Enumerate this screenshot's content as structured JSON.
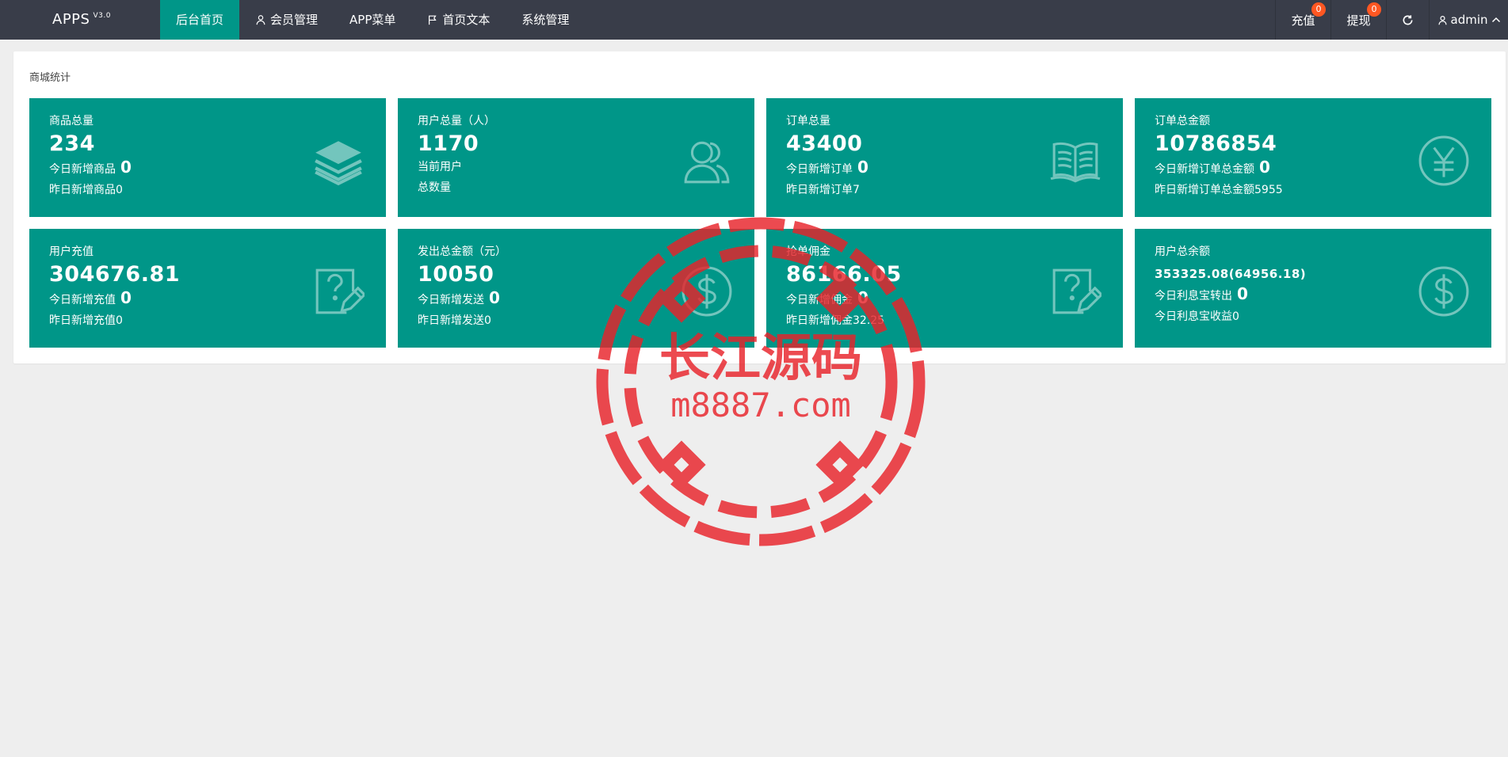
{
  "app": {
    "title": "APPS",
    "version": "V3.0"
  },
  "nav": {
    "items": [
      {
        "label": "后台首页",
        "icon": ""
      },
      {
        "label": "会员管理",
        "icon": "user-icon"
      },
      {
        "label": "APP菜单",
        "icon": ""
      },
      {
        "label": "首页文本",
        "icon": "flag-icon"
      },
      {
        "label": "系统管理",
        "icon": ""
      }
    ]
  },
  "right_nav": {
    "charge_label": "充值",
    "charge_badge": "0",
    "withdraw_label": "提现",
    "withdraw_badge": "0",
    "refresh_icon": "refresh-icon",
    "user_label": "admin"
  },
  "panel": {
    "title": "商城统计"
  },
  "cards": [
    {
      "title": "商品总量",
      "value": "234",
      "line1_label": "今日新增商品",
      "line1_value": "0",
      "line2_label": "昨日新增商品",
      "line2_value": "0",
      "icon": "layers-icon"
    },
    {
      "title": "用户总量（人）",
      "value": "1170",
      "line1_label": "当前用户",
      "line1_value": "",
      "line2_label": "总数量",
      "line2_value": "",
      "icon": "users-icon"
    },
    {
      "title": "订单总量",
      "value": "43400",
      "line1_label": "今日新增订单",
      "line1_value": "0",
      "line2_label": "昨日新增订单",
      "line2_value": "7",
      "icon": "book-icon"
    },
    {
      "title": "订单总金额",
      "value": "10786854",
      "line1_label": "今日新增订单总金额",
      "line1_value": "0",
      "line2_label": "昨日新增订单总金额",
      "line2_value": "5955",
      "icon": "yen-icon"
    },
    {
      "title": "用户充值",
      "value": "304676.81",
      "line1_label": "今日新增充值",
      "line1_value": "0",
      "line2_label": "昨日新增充值",
      "line2_value": "0",
      "icon": "question-doc-icon"
    },
    {
      "title": "发出总金额（元）",
      "value": "10050",
      "line1_label": "今日新增发送",
      "line1_value": "0",
      "line2_label": "昨日新增发送",
      "line2_value": "0",
      "icon": "dollar-icon"
    },
    {
      "title": "抢单佣金",
      "value": "86166.05",
      "line1_label": "今日新增佣金",
      "line1_value": "0",
      "line2_label": "昨日新增佣金",
      "line2_value": "32.25",
      "icon": "question-doc-icon"
    },
    {
      "title": "用户总余额",
      "value": "353325.08(64956.18)",
      "line1_label": "今日利息宝转出",
      "line1_value": "0",
      "line2_label": "今日利息宝收益",
      "line2_value": "0",
      "icon": "dollar-icon"
    }
  ],
  "watermark": {
    "title": "长江源码",
    "url": "m8887.com",
    "color": "#e8232a"
  },
  "colors": {
    "topbar": "#393d49",
    "accent": "#009688",
    "badge": "#ff5722",
    "background": "#eeeeee"
  }
}
